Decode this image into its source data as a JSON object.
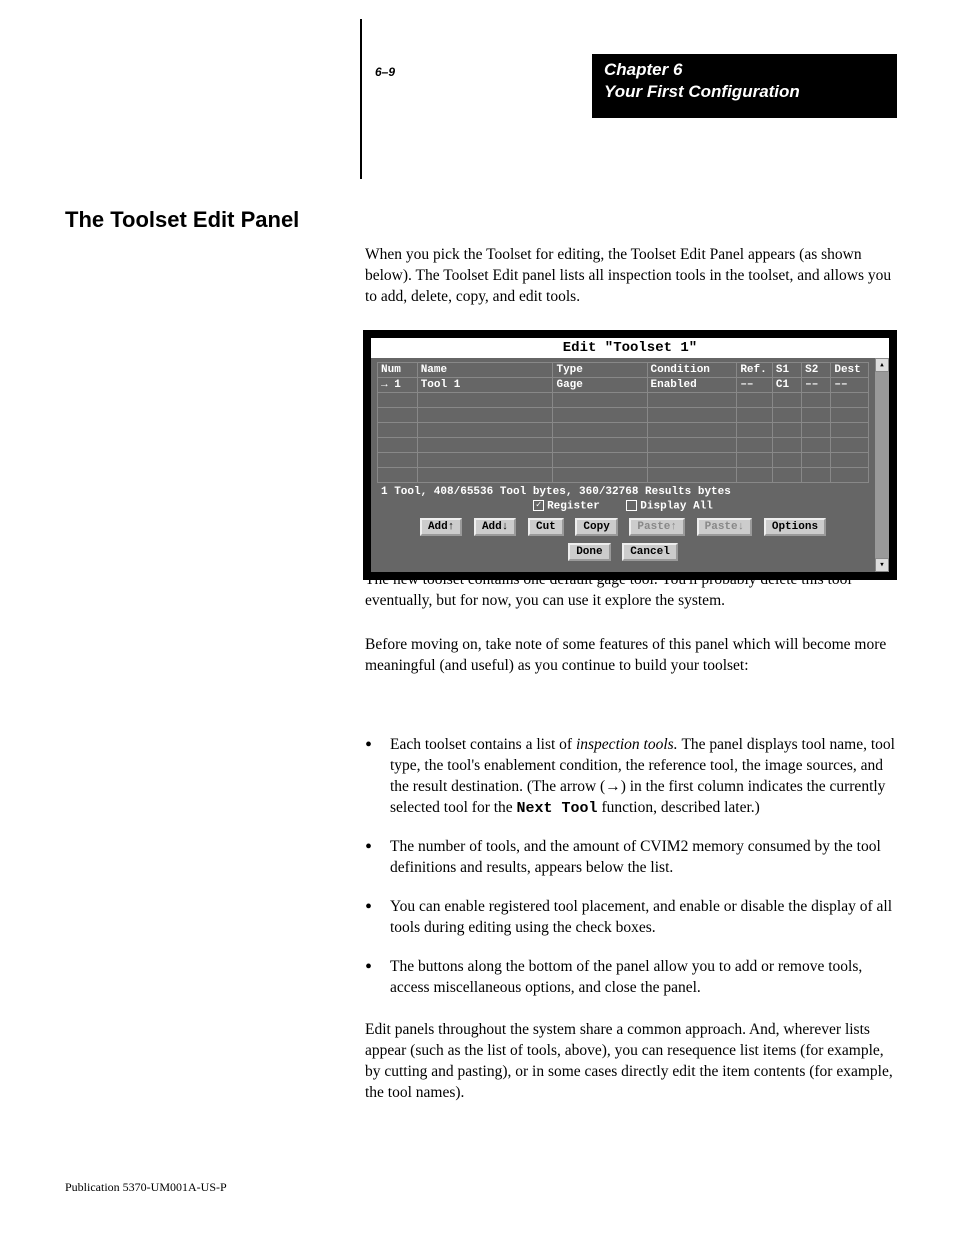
{
  "page_num_top": "6–9",
  "header_box": {
    "chapter": "Chapter 6",
    "title": "Your First Configuration"
  },
  "section_heading": "The Toolset Edit Panel",
  "para1": "When you pick the Toolset for editing, the Toolset Edit Panel appears (as shown below). The Toolset Edit panel lists all inspection tools in the toolset, and allows you to add, delete, copy, and edit tools.",
  "para2": "The new toolset contains one default gage tool. You'll probably delete this tool eventually, but for now, you can use it explore the system.",
  "para3": "Before moving on, take note of some features of this panel which will become more meaningful (and useful) as you continue to build your toolset:",
  "bullets": [
    {
      "pre": "Each toolset contains a list of ",
      "em": "inspection tools. ",
      "post": "The panel displays tool name, tool type, the tool's enablement condition, the reference tool, the image sources, and the result destination. (The arrow (",
      "arrow": "→",
      "post2": ") in the first column indicates the currently selected tool for the ",
      "mono": "Next Tool",
      "post3": " function, described later.)"
    },
    {
      "pre": "The number of tools, and the amount of CVIM2 memory consumed by the tool definitions and results, appears below the list."
    },
    {
      "pre": "You can enable registered tool placement, and enable or disable the display of all tools during editing using the check boxes."
    },
    {
      "pre": "The buttons along the bottom of the panel allow you to add or remove tools, access miscellaneous options, and close the panel."
    }
  ],
  "body2": "Edit panels throughout the system share a common approach. And, wherever lists appear (such as the list of tools, above), you can resequence list items (for example, by cutting and pasting), or in some cases directly edit the item contents (for example, the tool names).",
  "footer": "Publication 5370-UM001A-US-P",
  "dialog": {
    "title": "Edit \"Toolset 1\"",
    "columns": [
      "Num",
      "Name",
      "Type",
      "Condition",
      "Ref.",
      "S1",
      "S2",
      "Dest"
    ],
    "rows": [
      {
        "num": "→  1",
        "name": "Tool 1",
        "type": "Gage",
        "cond": "Enabled",
        "ref": "––",
        "s1": "C1",
        "s2": "––",
        "dest": "––"
      }
    ],
    "status": "1 Tool,    408/65536  Tool bytes,   360/32768 Results bytes",
    "check_register": "Register",
    "check_display_all": "Display All",
    "buttons_row1": [
      "Add↑",
      "Add↓",
      "Cut",
      "Copy",
      "Paste↑",
      "Paste↓",
      "Options"
    ],
    "buttons_row2": [
      "Done",
      "Cancel"
    ],
    "disabled_buttons": [
      "Paste↑",
      "Paste↓"
    ]
  }
}
